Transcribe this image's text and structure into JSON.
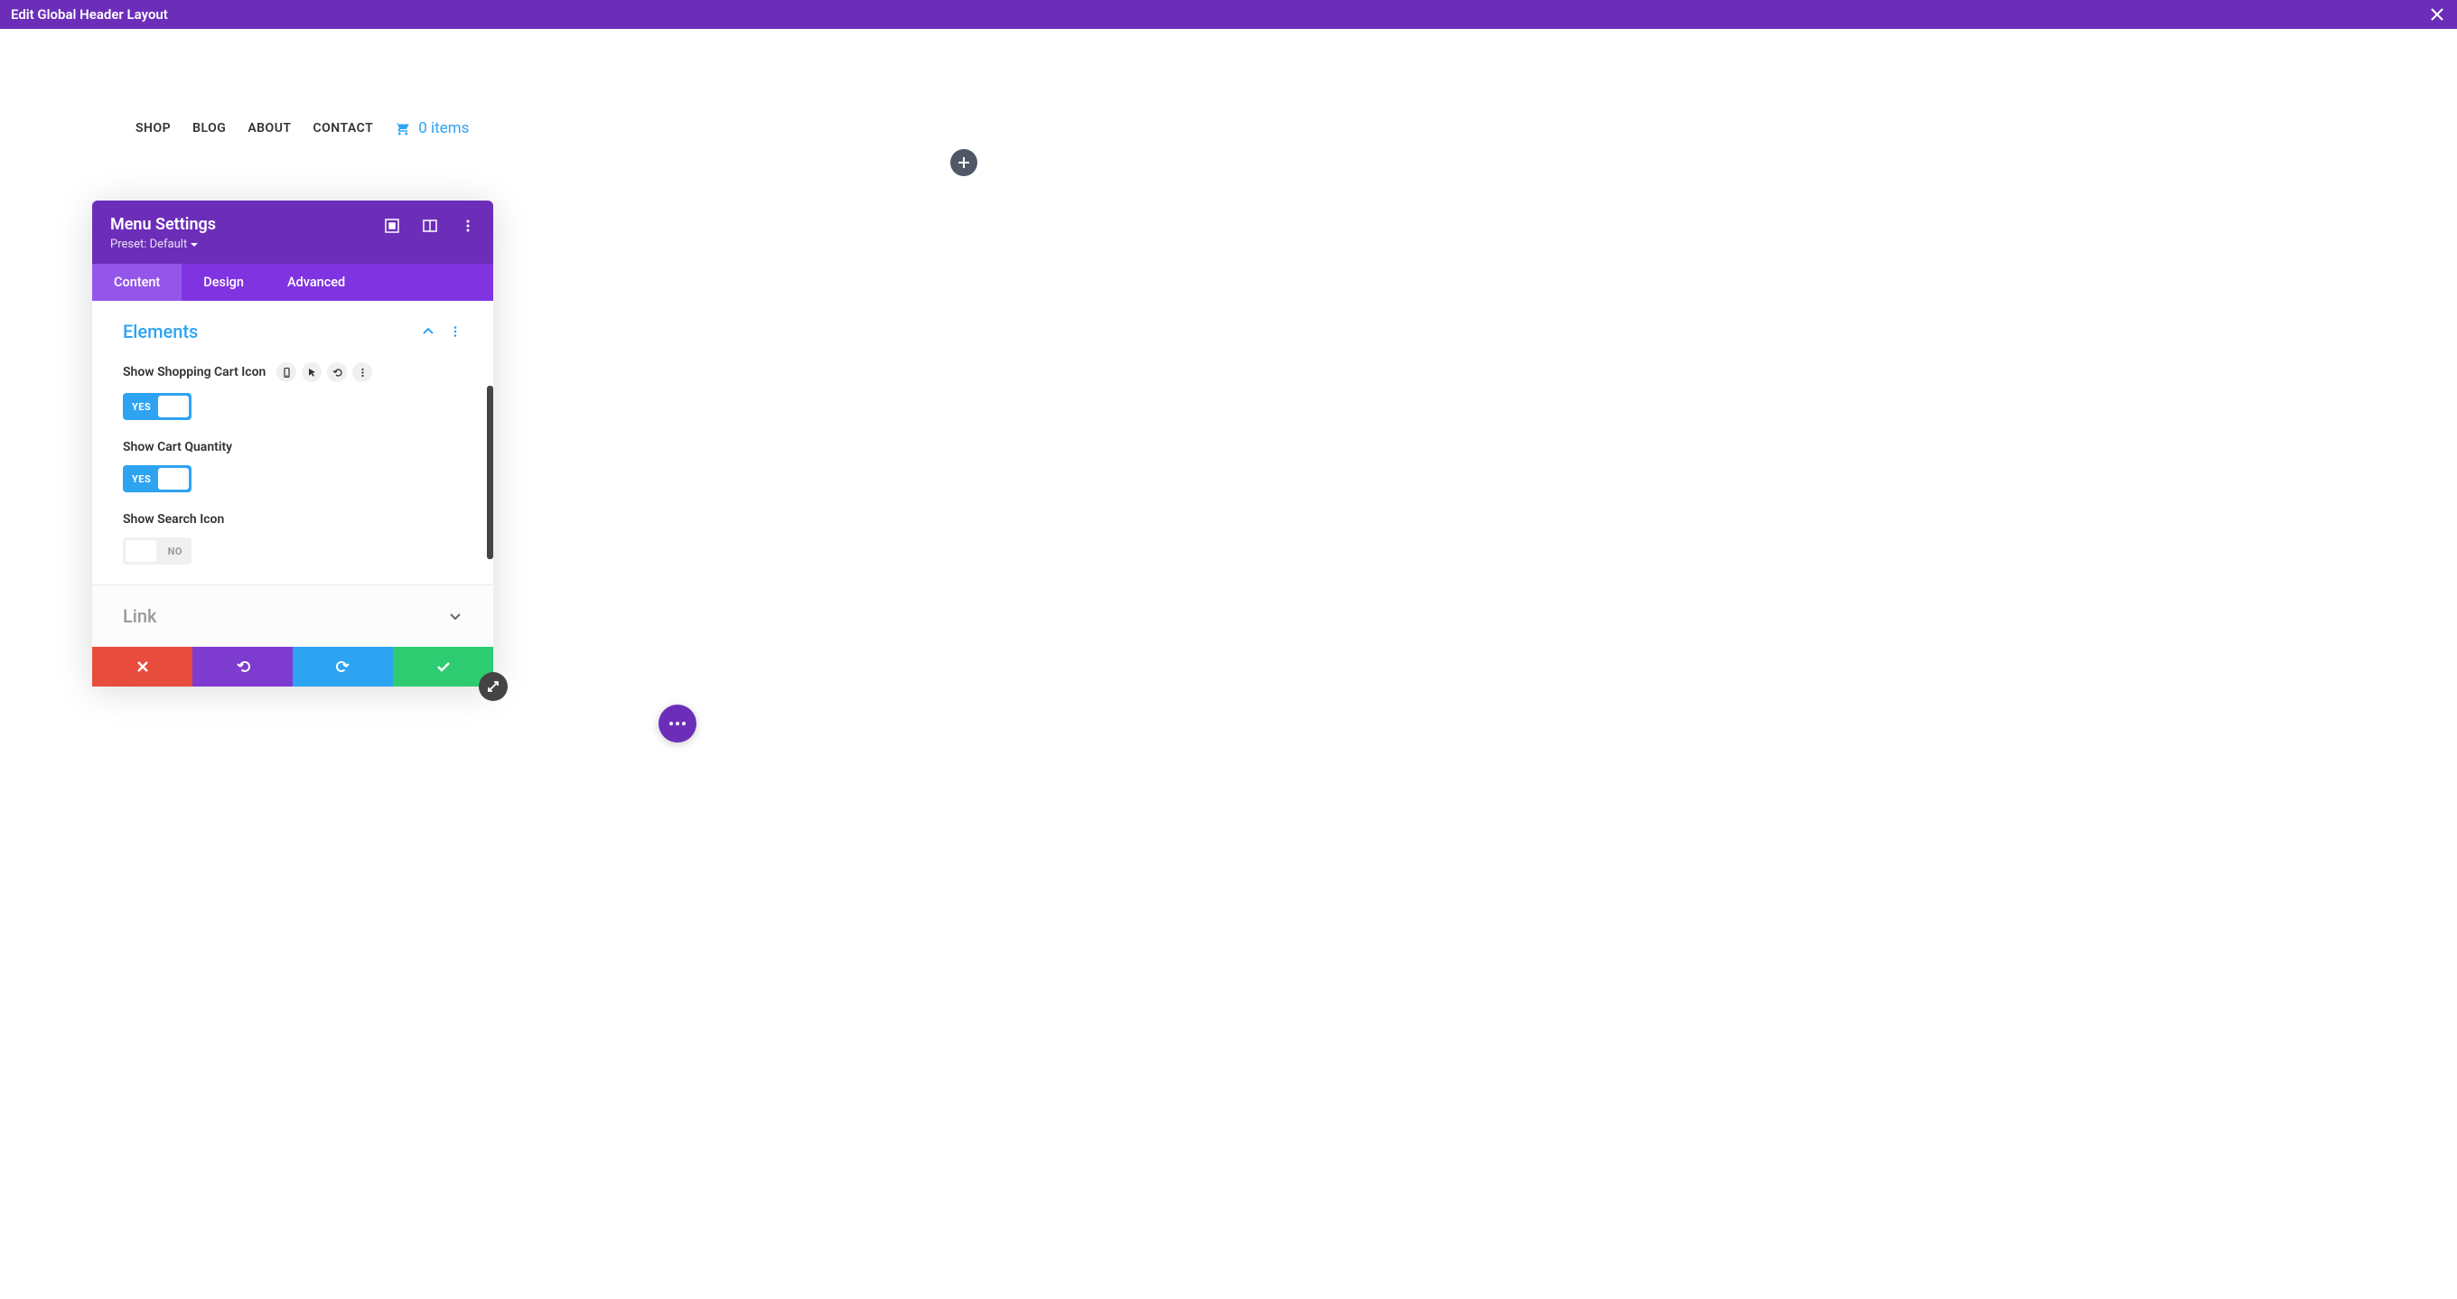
{
  "topbar": {
    "title": "Edit Global Header Layout"
  },
  "nav": {
    "items": [
      "SHOP",
      "BLOG",
      "ABOUT",
      "CONTACT"
    ],
    "cart_text": "0 items"
  },
  "panel": {
    "title": "Menu Settings",
    "preset_label": "Preset: Default",
    "tabs": {
      "content": "Content",
      "design": "Design",
      "advanced": "Advanced"
    },
    "sections": {
      "elements": {
        "title": "Elements",
        "fields": {
          "show_cart_icon": {
            "label": "Show Shopping Cart Icon",
            "value": true,
            "text": "YES"
          },
          "show_cart_qty": {
            "label": "Show Cart Quantity",
            "value": true,
            "text": "YES"
          },
          "show_search": {
            "label": "Show Search Icon",
            "value": false,
            "text": "NO"
          }
        }
      },
      "link": {
        "title": "Link"
      }
    }
  }
}
